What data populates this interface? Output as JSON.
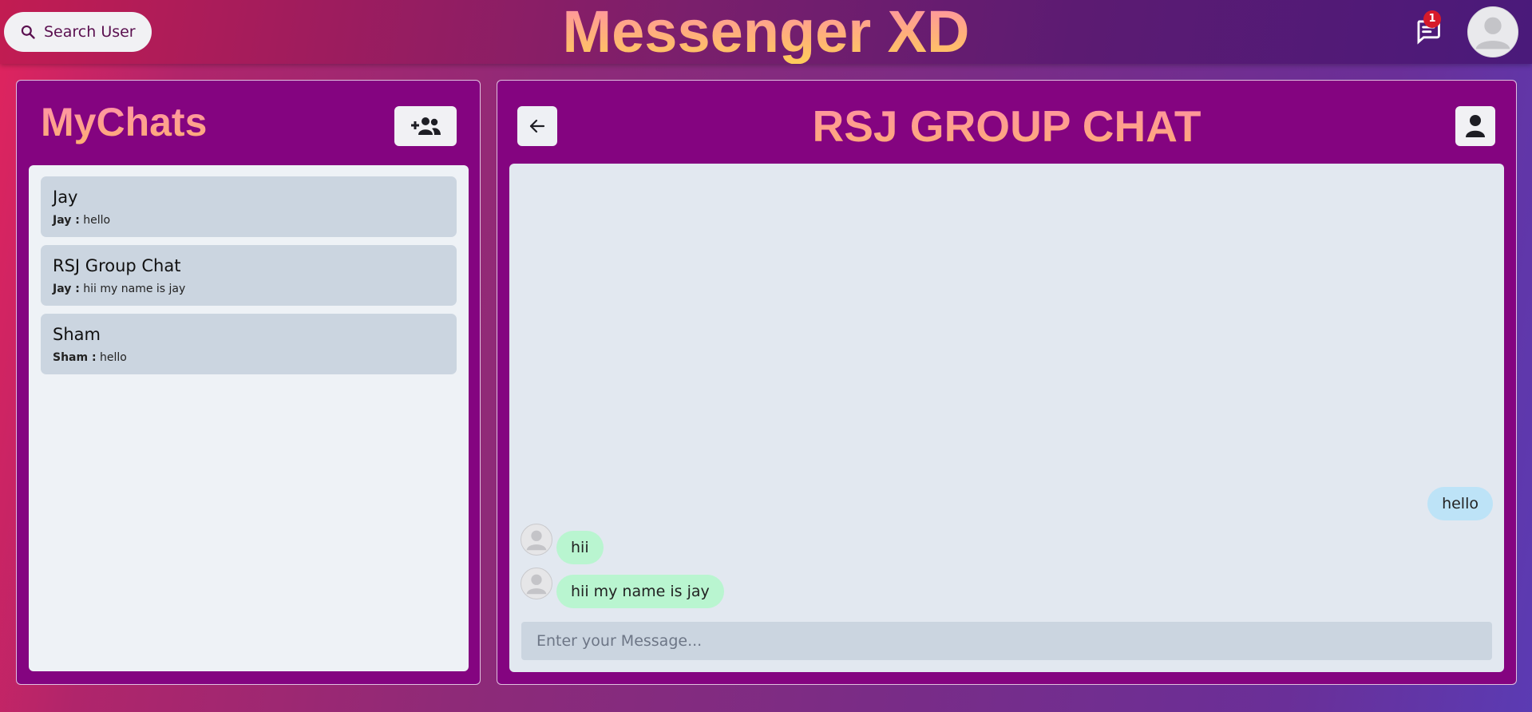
{
  "header": {
    "search_label": "Search User",
    "app_title": "Messenger XD",
    "notification_count": "1"
  },
  "sidebar": {
    "title": "MyChats",
    "chats": [
      {
        "name": "Jay",
        "sender": "Jay :",
        "message": "hello"
      },
      {
        "name": "RSJ Group Chat",
        "sender": "Jay :",
        "message": "hii my name is jay"
      },
      {
        "name": "Sham",
        "sender": "Sham :",
        "message": "hello"
      }
    ]
  },
  "chat": {
    "title": "RSJ GROUP CHAT",
    "messages": [
      {
        "text": "hello",
        "direction": "sent"
      },
      {
        "text": "hii",
        "direction": "received"
      },
      {
        "text": "hii my name is jay",
        "direction": "received"
      }
    ],
    "input_placeholder": "Enter your Message..."
  },
  "icons": {
    "search": "search-icon",
    "notification": "chat-bubble-icon",
    "avatar": "user-avatar-icon",
    "new_group": "add-group-icon",
    "back": "arrow-left-icon",
    "profile": "user-icon"
  },
  "colors": {
    "panel": "#840480",
    "chat_item": "#cbd5e0",
    "sent_bubble": "#bde3f7",
    "received_bubble": "#b9f5d0",
    "badge": "#d71a2a"
  }
}
